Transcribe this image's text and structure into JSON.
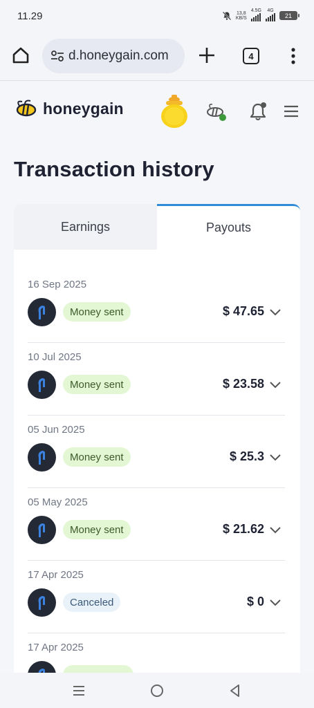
{
  "status_bar": {
    "time": "11.29",
    "net_speed_top": "13,8",
    "net_speed_unit": "KB/S",
    "network_1": "4.5G",
    "network_2": "4G",
    "battery": "21"
  },
  "browser": {
    "url": "d.honeygain.com",
    "tab_count": "4"
  },
  "site": {
    "brand": "honeygain"
  },
  "page": {
    "title": "Transaction history"
  },
  "tabs": [
    {
      "label": "Earnings",
      "active": false
    },
    {
      "label": "Payouts",
      "active": true
    }
  ],
  "transactions": [
    {
      "date": "16 Sep 2025",
      "status": "Money sent",
      "amount": "$ 47.65"
    },
    {
      "date": "10 Jul 2025",
      "status": "Money sent",
      "amount": "$ 23.58"
    },
    {
      "date": "05 Jun 2025",
      "status": "Money sent",
      "amount": "$ 25.3"
    },
    {
      "date": "05 May 2025",
      "status": "Money sent",
      "amount": "$ 21.62"
    },
    {
      "date": "17 Apr 2025",
      "status": "Canceled",
      "amount": "$ 0"
    },
    {
      "date": "17 Apr 2025",
      "status": "",
      "amount": ""
    }
  ],
  "colors": {
    "accent": "#2f8bd8",
    "sent_bg": "#e4f7d4",
    "cancel_bg": "#e9f1f9",
    "honey": "#f5c61b",
    "paypal_dark": "#232a36"
  }
}
